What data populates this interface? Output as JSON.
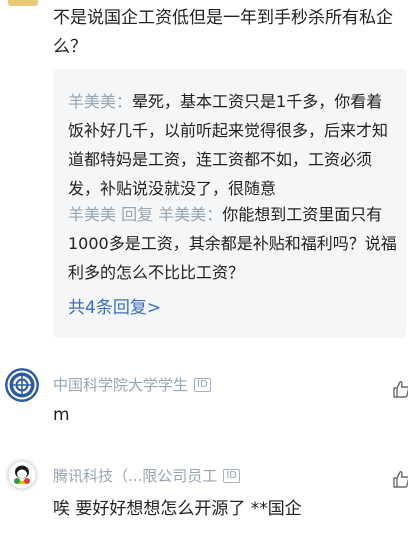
{
  "thread": {
    "comment_text": "不是说国企工资低但是一年到手秒杀所有私企么？",
    "replies": [
      {
        "user": "羊美美",
        "separator": "：",
        "text": "晕死，基本工资只是1千多，你看着饭补好几千，以前听起来觉得很多，后来才知道都特妈是工资，连工资都不如，工资必须发，补贴说没就没了，很随意"
      },
      {
        "user": "羊美美",
        "reply_word": "回复",
        "reply_to": "羊美美",
        "separator": "：",
        "text": "你能想到工资里面只有1000多是工资，其余都是补贴和福利吗？说福利多的怎么不比比工资？"
      }
    ],
    "more_replies_label": "共4条回复>"
  },
  "comments": [
    {
      "author": "中国科学院大学学生",
      "badge": "ID",
      "text": "m"
    },
    {
      "author": "腾讯科技（...限公司员工",
      "badge": "ID",
      "text": "唉 要好好想想怎么开源了 **国企"
    }
  ],
  "colors": {
    "text": "#222222",
    "muted": "#98a5b2",
    "link": "#3a6fc4",
    "reply_bg": "#f5f6f7"
  }
}
